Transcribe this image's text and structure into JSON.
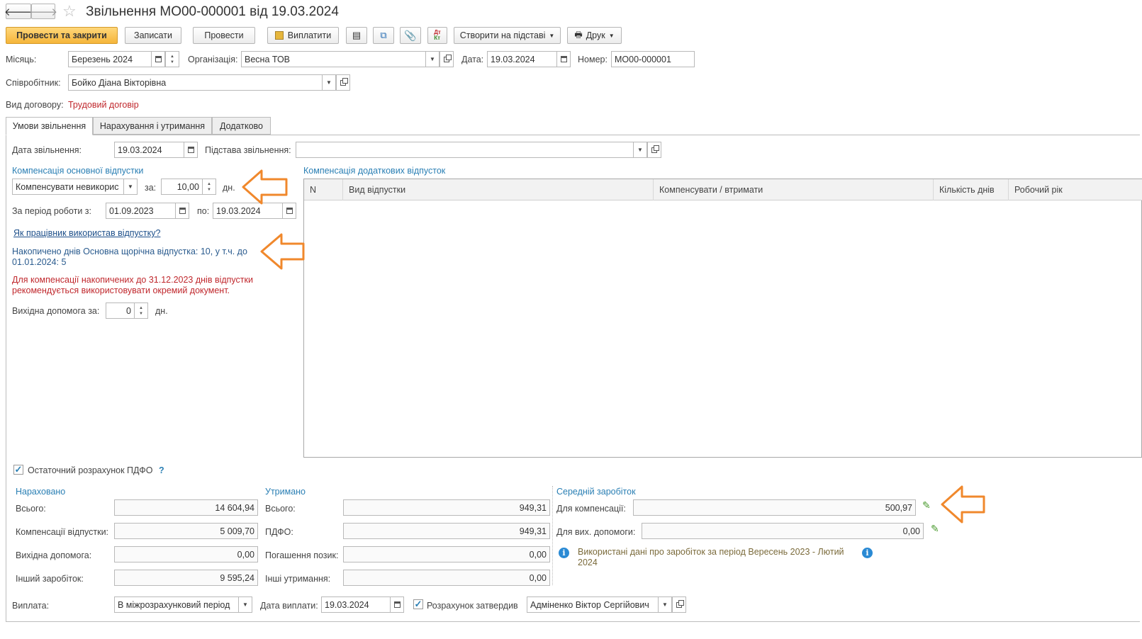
{
  "window": {
    "title": "Звільнення МО00-000001 від 19.03.2024"
  },
  "toolbar": {
    "post_close": "Провести та закрити",
    "save": "Записати",
    "post": "Провести",
    "pay": "Виплатити",
    "create_based": "Створити на підставі",
    "print": "Друк"
  },
  "header": {
    "month_label": "Місяць:",
    "month_value": "Березень 2024",
    "org_label": "Організація:",
    "org_value": "Весна ТОВ",
    "date_label": "Дата:",
    "date_value": "19.03.2024",
    "number_label": "Номер:",
    "number_value": "МО00-000001",
    "employee_label": "Співробітник:",
    "employee_value": "Бойко Діана Вікторівна",
    "contract_label": "Вид договору:",
    "contract_value": "Трудовий договір"
  },
  "tabs": [
    {
      "label": "Умови звільнення"
    },
    {
      "label": "Нарахування і утримання"
    },
    {
      "label": "Додатково"
    }
  ],
  "conditions": {
    "dismissal_date_label": "Дата звільнення:",
    "dismissal_date_value": "19.03.2024",
    "reason_label": "Підстава звільнення:",
    "reason_value": "",
    "main_comp_title": "Компенсація основної відпустки",
    "comp_mode_value": "Компенсувати невикорис",
    "for_label": "за:",
    "days_value": "10,00",
    "days_unit": "дн.",
    "period_from_label": "За період роботи з:",
    "period_from_value": "01.09.2023",
    "period_to_label": "по:",
    "period_to_value": "19.03.2024",
    "usage_link": "Як працівник використав відпустку?",
    "accrued_info": "Накопичено днів Основна щорічна відпустка: 10, у т.ч. до 01.01.2024: 5",
    "warning": "Для компенсації накопичених до 31.12.2023 днів відпустки рекомендується використовувати окремий документ.",
    "severance_label": "Вихідна допомога за:",
    "severance_value": "0",
    "severance_unit": "дн.",
    "extra_comp_title": "Компенсація додаткових відпусток",
    "table_headers": [
      "N",
      "Вид відпустки",
      "Компенсувати / втримати",
      "Кількість днів",
      "Робочий рік"
    ]
  },
  "pdfo": {
    "label": "Остаточний розрахунок ПДФО",
    "help": "?",
    "checked": true
  },
  "accrued": {
    "title": "Нараховано",
    "total_label": "Всього:",
    "total_value": "14 604,94",
    "vacation_label": "Компенсації відпустки:",
    "vacation_value": "5 009,70",
    "severance_label": "Вихідна допомога:",
    "severance_value": "0,00",
    "other_label": "Інший заробіток:",
    "other_value": "9 595,24"
  },
  "withheld": {
    "title": "Утримано",
    "total_label": "Всього:",
    "total_value": "949,31",
    "pdfo_label": "ПДФО:",
    "pdfo_value": "949,31",
    "loans_label": "Погашення позик:",
    "loans_value": "0,00",
    "other_label": "Інші утримання:",
    "other_value": "0,00"
  },
  "avg": {
    "title": "Середній заробіток",
    "comp_label": "Для компенсації:",
    "comp_value": "500,97",
    "sev_label": "Для вих. допомоги:",
    "sev_value": "0,00",
    "info": "Використані дані про заробіток за період Вересень 2023 - Лютий 2024"
  },
  "footer": {
    "payment_label": "Виплата:",
    "payment_value": "В міжрозрахунковий період",
    "pay_date_label": "Дата виплати:",
    "pay_date_value": "19.03.2024",
    "approved_label": "Розрахунок затвердив",
    "approved_value": "Адміненко Віктор Сергійович"
  },
  "colors": {
    "accent": "#2a7fb4",
    "warning": "#c0282d",
    "annotation": "#f0882c"
  }
}
